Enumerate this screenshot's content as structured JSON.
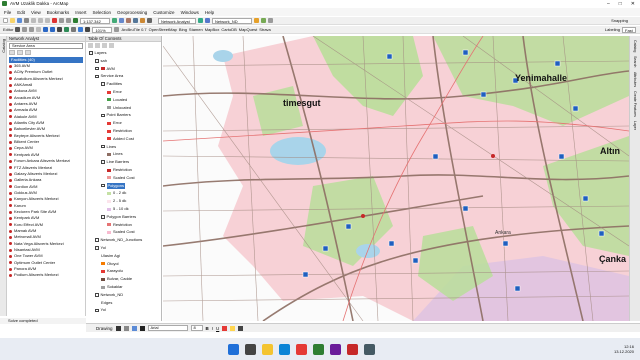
{
  "title": "AVM Uzaklik Dakka - ArcMap",
  "menu": [
    "File",
    "Edit",
    "View",
    "Bookmarks",
    "Insert",
    "Selection",
    "Geoprocessing",
    "Customize",
    "Windows",
    "Help"
  ],
  "toolbar": {
    "scale": "1:137.342",
    "network_analyst": "Network Analyst",
    "network_dataset": "Network_ND",
    "editor": "Editor",
    "zoom": "101%",
    "arcbrutile": "ArcBruTile 0.7",
    "services": [
      "OpenStreetMap",
      "Bing",
      "Stamen",
      "MapBox",
      "CartoDB",
      "MapQuest",
      "Strava"
    ],
    "labeling": "Labeling",
    "snapping": "Snapping",
    "fast": "Fast"
  },
  "network_panel": {
    "title": "Network Analyst",
    "layer": "Service Area",
    "facilities_header": "Facilities (40)",
    "facilities": [
      "365 AVM",
      "ACity Premium Outlet",
      "Anatolium Alisveris Merkezi",
      "ANKAmall",
      "Ankuva AVM",
      "Arcadium AVM",
      "Antares AVM",
      "Armada AVM",
      "Atakule AVM",
      "Atlantis City AVM",
      "Bahcelievler AVM",
      "Beytepe Alisveris Merkezi",
      "Bilkent Center",
      "Cepa AVM",
      "Kentpark AVM",
      "Forum Ankara Alisveris Merkezi",
      "FTZ Alisveris Merkezi",
      "Galaxy Alisveris Merkezi",
      "Galleria Ankara",
      "Gordion AVM",
      "Gokkus AVM",
      "Kanyon Alisveris Merkezi",
      "Karum",
      "Kecioren Park Site AVM",
      "Kentpark AVM",
      "Koru Effect AVM",
      "Mamak AVM",
      "Metromall AVM",
      "Nata Vega Alisveris Merkezi",
      "Nisantasi AVM",
      "One Tower AVM",
      "Optimum Outlet Center",
      "Panora AVM",
      "Podium Alisveris Merkezi"
    ],
    "status": "Solve completed"
  },
  "toc": {
    "title": "Table Of Contents",
    "rows": [
      {
        "label": "Layers",
        "level": 0,
        "check": true,
        "sw": ""
      },
      {
        "label": "sah",
        "level": 1,
        "check": true,
        "sw": ""
      },
      {
        "label": "AVM",
        "level": 1,
        "check": true,
        "sw": "#c62828"
      },
      {
        "label": "Service Area",
        "level": 1,
        "check": true,
        "sw": ""
      },
      {
        "label": "Facilities",
        "level": 2,
        "check": true,
        "sw": ""
      },
      {
        "label": "Error",
        "level": 3,
        "check": null,
        "sw": "#e53935"
      },
      {
        "label": "Located",
        "level": 3,
        "check": null,
        "sw": "#43a047"
      },
      {
        "label": "Unlocated",
        "level": 3,
        "check": null,
        "sw": "#9e9e9e"
      },
      {
        "label": "Point Barriers",
        "level": 2,
        "check": true,
        "sw": ""
      },
      {
        "label": "Error",
        "level": 3,
        "check": null,
        "sw": "#e53935"
      },
      {
        "label": "Restriction",
        "level": 3,
        "check": null,
        "sw": "#e53935"
      },
      {
        "label": "Added Cost",
        "level": 3,
        "check": null,
        "sw": "#e53935"
      },
      {
        "label": "Lines",
        "level": 2,
        "check": true,
        "sw": ""
      },
      {
        "label": "Lines",
        "level": 3,
        "check": null,
        "sw": "#8d6e63"
      },
      {
        "label": "Line Barriers",
        "level": 2,
        "check": true,
        "sw": ""
      },
      {
        "label": "Restriction",
        "level": 3,
        "check": null,
        "sw": "#c62828"
      },
      {
        "label": "Scaled Cost",
        "level": 3,
        "check": null,
        "sw": "#ef9a9a"
      },
      {
        "label": "Polygons",
        "level": 2,
        "check": true,
        "sw": "",
        "selected": true
      },
      {
        "label": "0 - 2 dk",
        "level": 3,
        "check": null,
        "sw": "#c5e1a5"
      },
      {
        "label": "2 - 5 dk",
        "level": 3,
        "check": null,
        "sw": "#fce4ec"
      },
      {
        "label": "5 - 10 dk",
        "level": 3,
        "check": null,
        "sw": "#e1bee7"
      },
      {
        "label": "Polygon Barriers",
        "level": 2,
        "check": true,
        "sw": ""
      },
      {
        "label": "Restriction",
        "level": 3,
        "check": null,
        "sw": "#e57373"
      },
      {
        "label": "Scaled Cost",
        "level": 3,
        "check": null,
        "sw": "#f8bbd0"
      },
      {
        "label": "Network_ND_Junctions",
        "level": 1,
        "check": false,
        "sw": ""
      },
      {
        "label": "Yol",
        "level": 1,
        "check": true,
        "sw": ""
      },
      {
        "label": "Ulasim Agi",
        "level": 2,
        "check": null,
        "sw": ""
      },
      {
        "label": "Otoyol",
        "level": 2,
        "check": null,
        "sw": "#f57c00"
      },
      {
        "label": "Karayolu",
        "level": 2,
        "check": null,
        "sw": "#e53935"
      },
      {
        "label": "Bulvar, Cadde",
        "level": 2,
        "check": null,
        "sw": "#6d4c41"
      },
      {
        "label": "Sokaklar",
        "level": 2,
        "check": null,
        "sw": "#9e9e9e"
      },
      {
        "label": "Network_ND",
        "level": 1,
        "check": false,
        "sw": ""
      },
      {
        "label": "Edges",
        "level": 2,
        "check": null,
        "sw": ""
      },
      {
        "label": "Yol",
        "level": 1,
        "check": false,
        "sw": ""
      }
    ]
  },
  "map": {
    "places": [
      "Yenimahalle",
      "timesgut",
      "Altın",
      "Ankara",
      "Çanka"
    ],
    "sidetabs": [
      "Catalog",
      "Search",
      "Attributes",
      "Create Features",
      "Layer"
    ]
  },
  "drawing": {
    "label": "Drawing",
    "font": "Arial",
    "size": "8"
  },
  "tray": {
    "time": "12:16",
    "date": "13.12.2020"
  }
}
